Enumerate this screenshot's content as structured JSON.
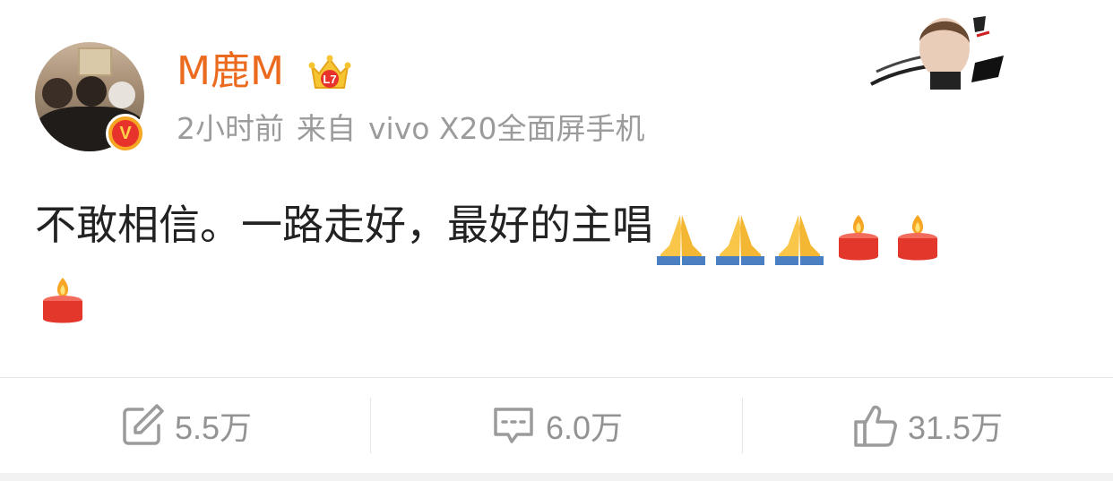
{
  "user": {
    "name": "M鹿M",
    "verified_badge": "V",
    "crown_badge": "L7"
  },
  "meta": {
    "time": "2小时前",
    "source_prefix": "来自",
    "source_device": "vivo X20全面屏手机"
  },
  "post": {
    "text": "不敢相信。一路走好，最好的主唱",
    "emojis_line1": [
      "folded-hands",
      "folded-hands",
      "folded-hands",
      "candle",
      "candle"
    ],
    "emojis_line2": [
      "candle"
    ]
  },
  "actions": {
    "repost_count": "5.5万",
    "comment_count": "6.0万",
    "like_count": "31.5万"
  },
  "colors": {
    "username": "#ec6a1e",
    "meta": "#9b9b9b",
    "action": "#939393",
    "badge_orange": "#f5a623",
    "badge_red": "#e8322c"
  },
  "icons": {
    "repost": "repost-icon",
    "comment": "comment-icon",
    "like": "thumbs-up-icon"
  }
}
